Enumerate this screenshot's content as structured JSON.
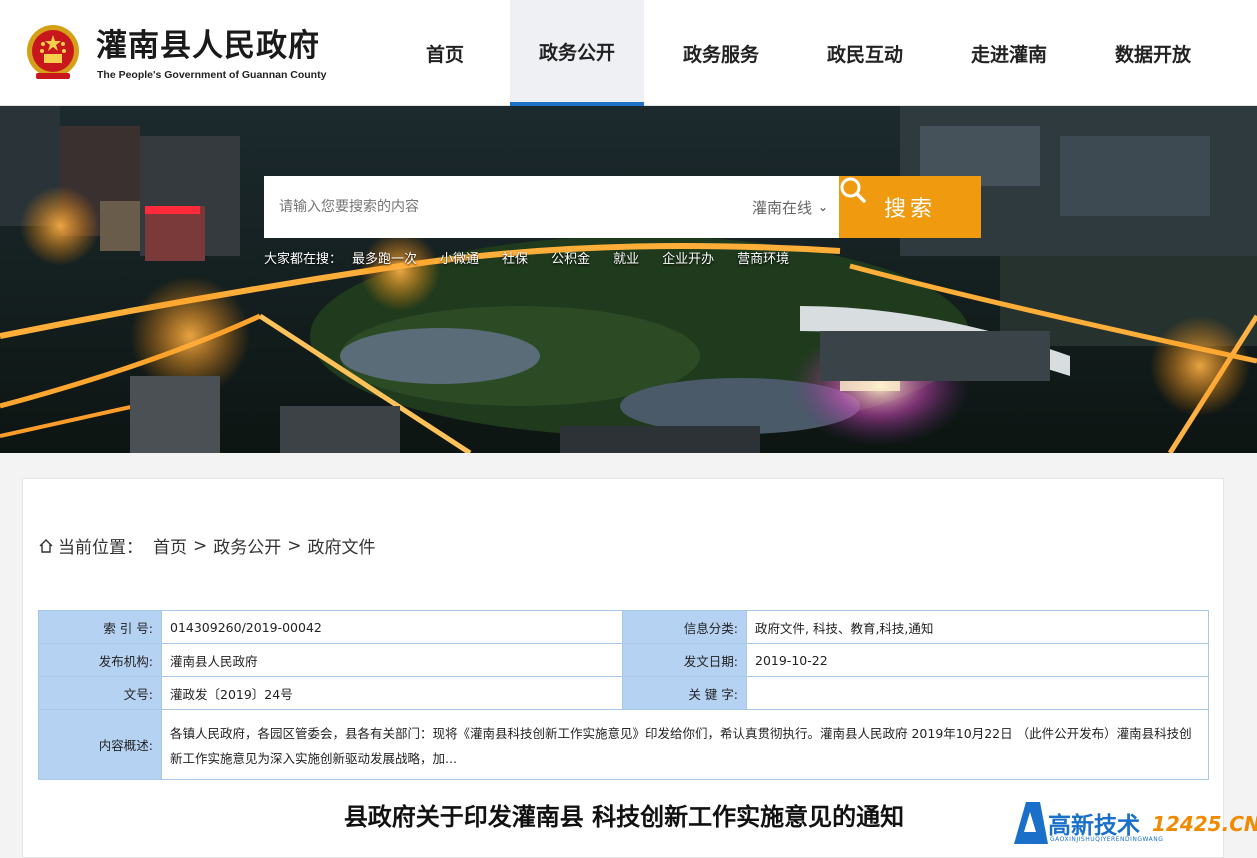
{
  "header": {
    "title": "灌南县人民政府",
    "subtitle": "The People's Government of Guannan County",
    "nav": [
      {
        "label": "首页",
        "active": false
      },
      {
        "label": "政务公开",
        "active": true
      },
      {
        "label": "政务服务",
        "active": false
      },
      {
        "label": "政民互动",
        "active": false
      },
      {
        "label": "走进灌南",
        "active": false
      },
      {
        "label": "数据开放",
        "active": false
      }
    ]
  },
  "search": {
    "placeholder": "请输入您要搜索的内容",
    "scope": "灌南在线",
    "button_label": "搜索",
    "hot_label": "大家都在搜：",
    "hot_links": [
      "最多跑一次",
      "小微通",
      "社保",
      "公积金",
      "就业",
      "企业开办",
      "营商环境"
    ]
  },
  "breadcrumb": {
    "label": "当前位置：",
    "items": [
      "首页",
      "政务公开",
      "政府文件"
    ],
    "separator": ">"
  },
  "meta": {
    "index_label": "索 引 号:",
    "index_value": "014309260/2019-00042",
    "category_label": "信息分类:",
    "category_value": "政府文件, 科技、教育,科技,通知",
    "publisher_label": "发布机构:",
    "publisher_value": "灌南县人民政府",
    "date_label": "发文日期:",
    "date_value": "2019-10-22",
    "docno_label": "文号:",
    "docno_value": "灌政发〔2019〕24号",
    "keywords_label": "关 键 字:",
    "keywords_value": "",
    "summary_label": "内容概述:",
    "summary_value": "各镇人民政府，各园区管委会，县各有关部门：现将《灌南县科技创新工作实施意见》印发给你们，希认真贯彻执行。灌南县人民政府 2019年10月22日 （此件公开发布）灌南县科技创新工作实施意见为深入实施创新驱动发展战略，加..."
  },
  "document": {
    "title": "县政府关于印发灌南县 科技创新工作实施意见的通知"
  },
  "watermark": {
    "text": "高新技术",
    "number": "12425",
    "suffix": ".CN",
    "sub": "GAOXINJISHUQIYERENDINGWANG"
  },
  "colors": {
    "accent_blue": "#1f73c4",
    "search_button": "#ef9a0f",
    "table_label_bg": "#b5d2f2",
    "table_border": "#a9c7e6"
  }
}
